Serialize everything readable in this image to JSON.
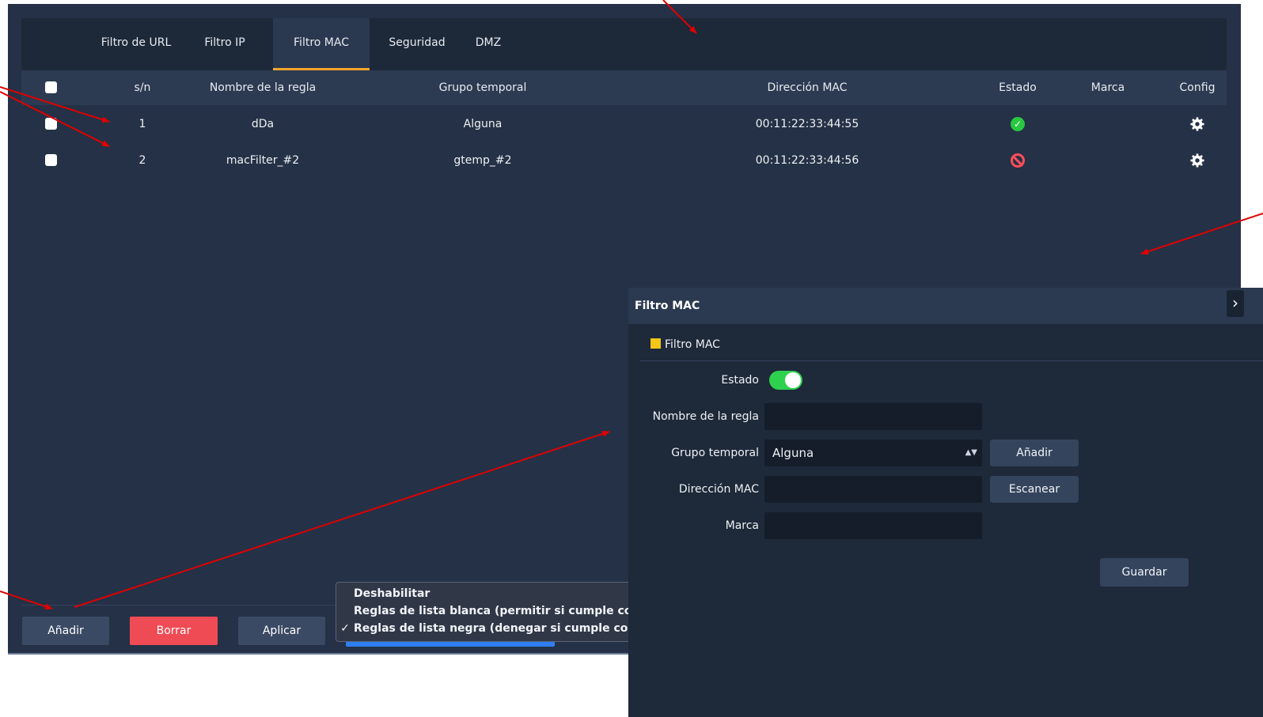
{
  "tabs": [
    {
      "label": "Filtro de URL",
      "active": false
    },
    {
      "label": "Filtro IP",
      "active": false
    },
    {
      "label": "Filtro MAC",
      "active": true
    },
    {
      "label": "Seguridad",
      "active": false
    },
    {
      "label": "DMZ",
      "active": false
    }
  ],
  "table": {
    "columns": [
      "s/n",
      "Nombre de la regla",
      "Grupo temporal",
      "Dirección MAC",
      "Estado",
      "Marca",
      "Config"
    ],
    "rows": [
      {
        "sn": "1",
        "name": "dDa",
        "group": "Alguna",
        "mac": "00:11:22:33:44:55",
        "status": "enabled",
        "mark": ""
      },
      {
        "sn": "2",
        "name": "macFilter_#2",
        "group": "gtemp_#2",
        "mac": "00:11:22:33:44:56",
        "status": "disabled",
        "mark": ""
      }
    ]
  },
  "footer": {
    "add_label": "Añadir",
    "delete_label": "Borrar",
    "apply_label": "Aplicar"
  },
  "mode_menu": {
    "items": [
      {
        "label": "Deshabilitar",
        "checked": false
      },
      {
        "label": "Reglas de lista blanca (permitir si cumple cond",
        "checked": false
      },
      {
        "label": "Reglas de lista negra (denegar si cumple cond",
        "checked": true
      }
    ],
    "check_glyph": "✓"
  },
  "modal": {
    "title": "Filtro MAC",
    "section_title": "Filtro MAC",
    "fields": {
      "status_label": "Estado",
      "status_on": true,
      "name_label": "Nombre de la regla",
      "name_value": "",
      "group_label": "Grupo temporal",
      "group_value": "Alguna",
      "mac_label": "Dirección MAC",
      "mac_value": "",
      "mark_label": "Marca",
      "mark_value": ""
    },
    "add_label": "Añadir",
    "scan_label": "Escanear",
    "save_label": "Guardar",
    "close_glyph": "›"
  },
  "colors": {
    "accent_orange": "#f2a52b",
    "status_ok": "#28c840",
    "status_blocked": "#ff4d5a",
    "toggle_on": "#2ed14d",
    "delete_red": "#ef4b55",
    "annotation_arrow": "#e00000"
  },
  "icons": {
    "status_enabled": "check-circle-icon",
    "status_disabled": "block-icon",
    "config": "gear-icon",
    "close": "close-icon",
    "section": "square-icon"
  }
}
